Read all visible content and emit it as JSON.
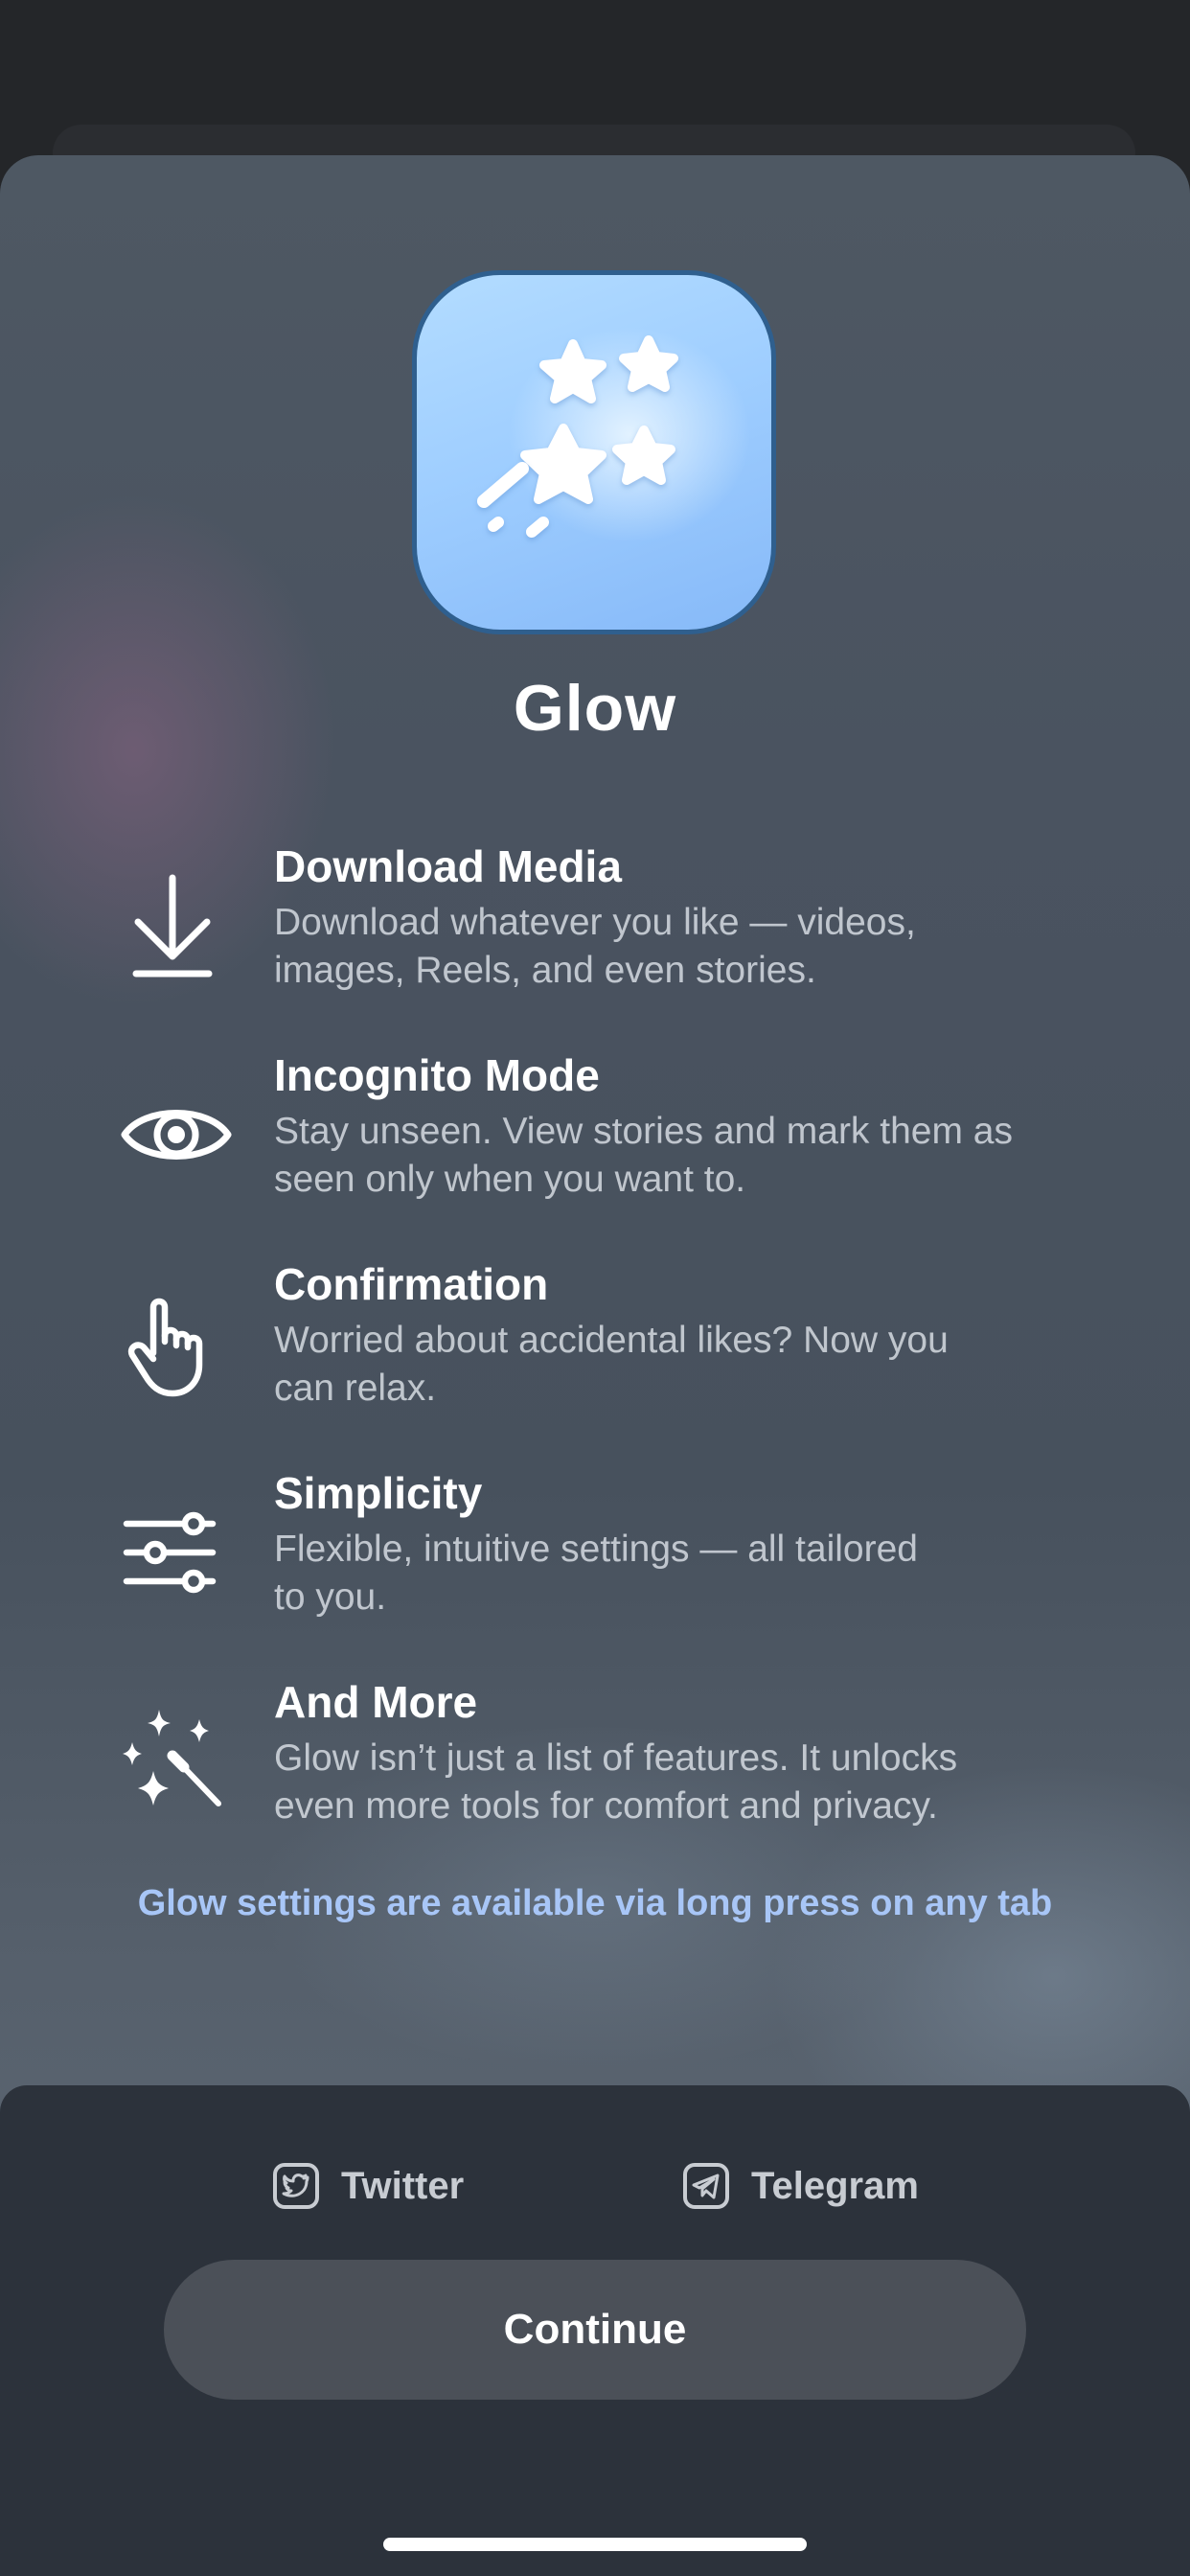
{
  "app": {
    "name": "Glow"
  },
  "features": [
    {
      "icon": "download-icon",
      "title": "Download Media",
      "desc_line1": "Download whatever you like — videos,",
      "desc_line2": "images, Reels, and even stories."
    },
    {
      "icon": "eye-icon",
      "title": "Incognito Mode",
      "desc_line1": "Stay unseen. View stories and mark them as",
      "desc_line2": "seen only when you want to."
    },
    {
      "icon": "hand-pointer-icon",
      "title": "Confirmation",
      "desc_line1": "Worried about accidental likes? Now you",
      "desc_line2": "can relax."
    },
    {
      "icon": "sliders-icon",
      "title": "Simplicity",
      "desc_line1": "Flexible, intuitive settings — all tailored",
      "desc_line2": "to you."
    },
    {
      "icon": "magic-wand-icon",
      "title": "And More",
      "desc_line1": "Glow isn’t just a list of features. It unlocks",
      "desc_line2": "even more tools for comfort and privacy."
    }
  ],
  "hint": "Glow settings are available via long press on any tab",
  "footer": {
    "twitter_label": "Twitter",
    "telegram_label": "Telegram",
    "continue_label": "Continue"
  },
  "colors": {
    "accent_hint": "#a8c6f7",
    "button_bg": "#4b5058",
    "footer_bg": "#2c323b"
  }
}
